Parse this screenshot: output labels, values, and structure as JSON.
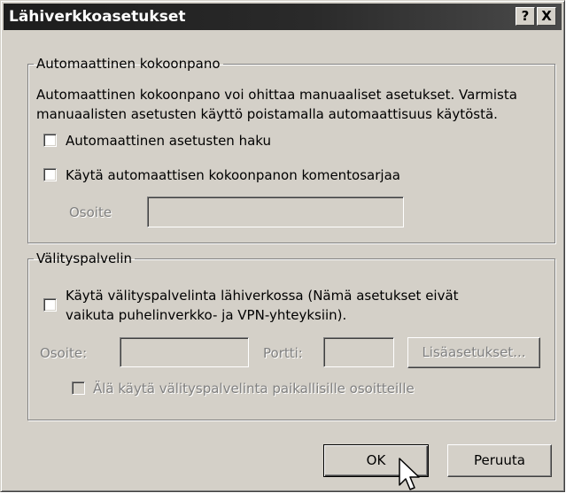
{
  "window": {
    "title": "Lähiverkkoasetukset",
    "help_label": "?",
    "close_label": "X"
  },
  "auto_config": {
    "legend": "Automaattinen kokoonpano",
    "description_line1": "Automaattinen kokoonpano voi ohittaa manuaaliset asetukset. Varmista",
    "description_line2": "manuaalisten asetusten käyttö poistamalla automaattisuus käytöstä.",
    "auto_detect_label": "Automaattinen asetusten haku",
    "auto_detect_checked": false,
    "use_script_label": "Käytä automaattisen kokoonpanon komentosarjaa",
    "use_script_checked": false,
    "address_label": "Osoite",
    "address_value": ""
  },
  "proxy": {
    "legend": "Välityspalvelin",
    "use_proxy_line1": "Käytä välityspalvelinta lähiverkossa (Nämä asetukset eivät",
    "use_proxy_line2": "vaikuta puhelinverkko- ja VPN-yhteyksiin).",
    "use_proxy_checked": false,
    "address_label": "Osoite:",
    "address_value": "",
    "port_label": "Portti:",
    "port_value": "",
    "advanced_label": "Lisäasetukset...",
    "bypass_label": "Älä käytä välityspalvelinta paikallisille osoitteille",
    "bypass_checked": false
  },
  "buttons": {
    "ok_label": "OK",
    "cancel_label": "Peruuta"
  },
  "colors": {
    "dialog_face": "#d4d0c8",
    "titlebar": "#1d1d1d",
    "disabled_text": "#808080"
  },
  "icons": {
    "cursor": "arrow-cursor-icon"
  }
}
